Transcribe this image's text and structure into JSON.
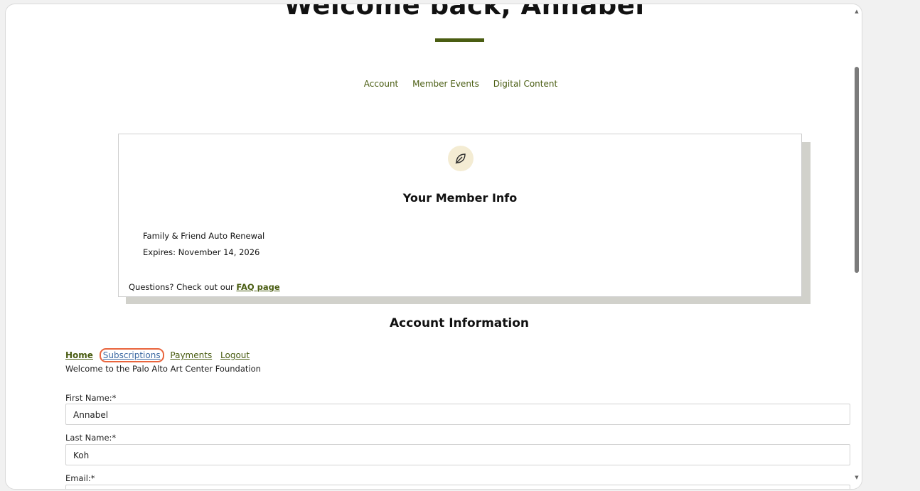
{
  "header": {
    "welcome": "Welcome back, Annabel"
  },
  "nav": {
    "items": [
      "Account",
      "Member Events",
      "Digital Content"
    ]
  },
  "member_card": {
    "icon": "leaf-icon",
    "title": "Your Member Info",
    "plan": "Family & Friend Auto Renewal",
    "expires": "Expires: November 14, 2026",
    "faq_prefix": "Questions? Check out our ",
    "faq_link": "FAQ page"
  },
  "account": {
    "title": "Account Information",
    "subnav": [
      "Home",
      "Subscriptions",
      "Payments",
      "Logout"
    ],
    "description": "Welcome to the Palo Alto Art Center Foundation",
    "fields": {
      "first_name_label": "First Name:*",
      "first_name_value": "Annabel",
      "last_name_label": "Last Name:*",
      "last_name_value": "Koh",
      "email_label": "Email:*"
    }
  },
  "colors": {
    "accent": "#4a5d12",
    "highlight": "#e9643c",
    "link_visited": "#3d6aa3"
  }
}
